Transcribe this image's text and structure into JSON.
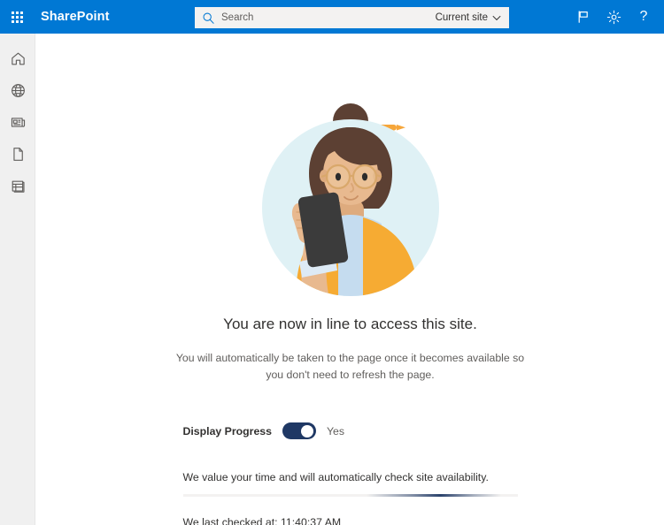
{
  "header": {
    "waffle_name": "app-launcher",
    "brand": "SharePoint",
    "search": {
      "placeholder": "Search",
      "value": "",
      "scope_label": "Current site"
    },
    "actions": [
      {
        "name": "flag-icon",
        "label": "Flag"
      },
      {
        "name": "gear-icon",
        "label": "Settings"
      },
      {
        "name": "help-icon",
        "label": "?"
      }
    ],
    "colors": {
      "bar": "#0078d4",
      "text": "#ffffff",
      "search_bg": "#f3f2f1"
    }
  },
  "sidebar": {
    "items": [
      {
        "name": "sidebar-item-home",
        "icon": "home-icon",
        "label": "Home"
      },
      {
        "name": "sidebar-item-sites",
        "icon": "globe-icon",
        "label": "Sites"
      },
      {
        "name": "sidebar-item-news",
        "icon": "news-icon",
        "label": "News"
      },
      {
        "name": "sidebar-item-files",
        "icon": "page-icon",
        "label": "Files"
      },
      {
        "name": "sidebar-item-lists",
        "icon": "list-icon",
        "label": "Lists"
      }
    ],
    "bg": "#f0f0f0"
  },
  "main": {
    "illustration": {
      "name": "person-with-phone-illustration",
      "circle_color": "#dff1f5",
      "hair_color": "#5c4033",
      "skin_color": "#e8b98f",
      "jacket_color": "#f6ab33",
      "shirt_color": "#c5dcef",
      "phone_color": "#3b3b3b",
      "hairstick_color": "#f6a63a"
    },
    "headline": "You are now in line to access this site.",
    "subtext": "You will automatically be taken to the page once it becomes available so you don't need to refresh the page.",
    "display_progress": {
      "label": "Display Progress",
      "state_label": "Yes",
      "on": true,
      "accent": "#1f3864"
    },
    "availability_text": "We value your time and will automatically check site availability.",
    "progress": {
      "indeterminate": true,
      "accent": "#1f3864",
      "track": "#f3f2f1"
    },
    "last_checked": "We last checked at: 11:40:37 AM"
  }
}
